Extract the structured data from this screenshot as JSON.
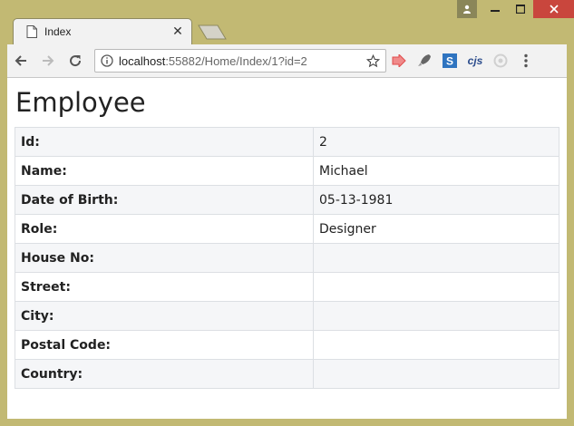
{
  "browser": {
    "tab_title": "Index",
    "url_host": "localhost",
    "url_path": ":55882/Home/Index/1?id=2",
    "extensions": [
      "red-arrow-extension-icon",
      "rocket-extension-icon",
      "s-extension-icon",
      "cjs-extension-icon",
      "circle-extension-icon"
    ],
    "cjs_label": "cjs"
  },
  "page": {
    "title": "Employee",
    "rows": [
      {
        "label": "Id:",
        "value": "2"
      },
      {
        "label": "Name:",
        "value": "Michael"
      },
      {
        "label": "Date of Birth:",
        "value": "05-13-1981"
      },
      {
        "label": "Role:",
        "value": "Designer"
      },
      {
        "label": "House No:",
        "value": ""
      },
      {
        "label": "Street:",
        "value": ""
      },
      {
        "label": "City:",
        "value": ""
      },
      {
        "label": "Postal Code:",
        "value": ""
      },
      {
        "label": "Country:",
        "value": ""
      }
    ]
  }
}
